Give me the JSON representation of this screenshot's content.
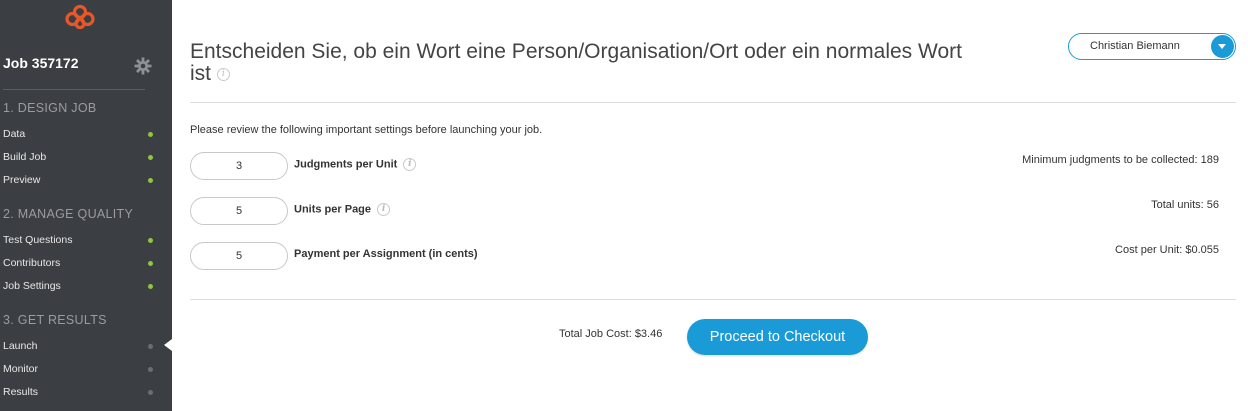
{
  "sidebar": {
    "job_title": "Job 357172",
    "sections": [
      {
        "heading": "1. DESIGN JOB",
        "items": [
          {
            "label": "Data",
            "status": "complete"
          },
          {
            "label": "Build Job",
            "status": "complete"
          },
          {
            "label": "Preview",
            "status": "complete"
          }
        ]
      },
      {
        "heading": "2. MANAGE QUALITY",
        "items": [
          {
            "label": "Test Questions",
            "status": "complete"
          },
          {
            "label": "Contributors",
            "status": "complete"
          },
          {
            "label": "Job Settings",
            "status": "complete"
          }
        ]
      },
      {
        "heading": "3. GET RESULTS",
        "items": [
          {
            "label": "Launch",
            "status": "active"
          },
          {
            "label": "Monitor",
            "status": "pending"
          },
          {
            "label": "Results",
            "status": "pending"
          }
        ]
      }
    ]
  },
  "header": {
    "page_title": "Entscheiden Sie, ob ein Wort eine Person/Organisation/Ort oder ein normales Wort ist",
    "user_name": "Christian Biemann"
  },
  "launch": {
    "intro": "Please review the following important settings before launching your job.",
    "settings": [
      {
        "label": "Judgments per Unit",
        "value": "3",
        "has_info": true,
        "stat": "Minimum judgments to be collected: 189"
      },
      {
        "label": "Units per Page",
        "value": "5",
        "has_info": true,
        "stat": "Total units: 56"
      },
      {
        "label": "Payment per Assignment (in cents)",
        "value": "5",
        "has_info": false,
        "stat": "Cost per Unit: $0.055"
      }
    ],
    "total_cost": "Total Job Cost: $3.46",
    "checkout_label": "Proceed to Checkout"
  },
  "icons": {
    "info": "i"
  },
  "colors": {
    "sidebar_bg": "#3b3e42",
    "accent_blue": "#1a9bd7",
    "status_green": "#8dc63f",
    "logo_orange": "#e8572a"
  }
}
